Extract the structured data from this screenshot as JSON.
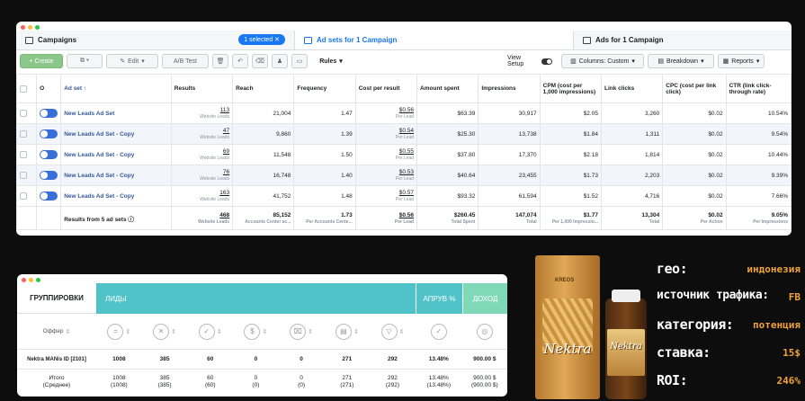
{
  "fb": {
    "tabs": {
      "campaigns": "Campaigns",
      "selected": "1 selected",
      "adsets": "Ad sets for 1 Campaign",
      "ads": "Ads for 1 Campaign"
    },
    "toolbar": {
      "create": "+ Create",
      "edit": "Edit",
      "abtest": "A/B Test",
      "rules": "Rules",
      "view_setup": "View Setup",
      "columns": "Columns: Custom",
      "breakdown": "Breakdown",
      "reports": "Reports"
    },
    "headers": [
      "Ad set",
      "Results",
      "Reach",
      "Frequency",
      "Cost per result",
      "Amount spent",
      "Impressions",
      "CPM (cost per 1,000 impressions)",
      "Link clicks",
      "CPC (cost per link click)",
      "CTR (link click-through rate)"
    ],
    "rows": [
      {
        "name": "New Leads Ad Set",
        "results": "113",
        "results_sub": "Website Leads",
        "reach": "21,004",
        "freq": "1.47",
        "cpr": "$0.56",
        "cpr_sub": "Per Lead",
        "spent": "$63.39",
        "impr": "30,917",
        "cpm": "$2.05",
        "clicks": "3,260",
        "cpc": "$0.02",
        "ctr": "10.54%"
      },
      {
        "name": "New Leads Ad Set - Copy",
        "results": "47",
        "results_sub": "Website Leads",
        "reach": "9,860",
        "freq": "1.39",
        "cpr": "$0.54",
        "cpr_sub": "Per Lead",
        "spent": "$25.30",
        "impr": "13,738",
        "cpm": "$1.84",
        "clicks": "1,311",
        "cpc": "$0.02",
        "ctr": "9.54%"
      },
      {
        "name": "New Leads Ad Set - Copy",
        "results": "69",
        "results_sub": "Website Leads",
        "reach": "11,548",
        "freq": "1.50",
        "cpr": "$0.55",
        "cpr_sub": "Per Lead",
        "spent": "$37.80",
        "impr": "17,370",
        "cpm": "$2.18",
        "clicks": "1,814",
        "cpc": "$0.02",
        "ctr": "10.44%"
      },
      {
        "name": "New Leads Ad Set - Copy",
        "results": "76",
        "results_sub": "Website Leads",
        "reach": "16,748",
        "freq": "1.40",
        "cpr": "$0.53",
        "cpr_sub": "Per Lead",
        "spent": "$40.64",
        "impr": "23,455",
        "cpm": "$1.73",
        "clicks": "2,203",
        "cpc": "$0.02",
        "ctr": "9.39%"
      },
      {
        "name": "New Leads Ad Set - Copy",
        "results": "163",
        "results_sub": "Website Leads",
        "reach": "41,752",
        "freq": "1.48",
        "cpr": "$0.57",
        "cpr_sub": "Per Lead",
        "spent": "$93.32",
        "impr": "61,594",
        "cpm": "$1.52",
        "clicks": "4,716",
        "cpc": "$0.02",
        "ctr": "7.66%"
      }
    ],
    "total": {
      "name": "Results from 5 ad sets",
      "results": "468",
      "results_sub": "Website Leads",
      "reach": "85,152",
      "reach_sub": "Accounts Center ac...",
      "freq": "1.73",
      "freq_sub": "Per Accounts Cente...",
      "cpr": "$0.56",
      "cpr_sub": "Per Lead",
      "spent": "$260.45",
      "spent_sub": "Total Spent",
      "impr": "147,074",
      "impr_sub": "Total",
      "cpm": "$1.77",
      "cpm_sub": "Per 1,000 Impressio...",
      "clicks": "13,304",
      "clicks_sub": "Total",
      "cpc": "$0.02",
      "cpc_sub": "Per Action",
      "ctr": "9.05%",
      "ctr_sub": "Per Impressions"
    }
  },
  "sheet": {
    "grouping": "ГРУППИРОВКИ",
    "leads": "ЛИДЫ",
    "approve": "АПРУВ %",
    "income": "ДОХОД",
    "offer": "Оффер",
    "row1": {
      "label": "Nektra MANis ID [2101]",
      "vals": [
        "1008",
        "385",
        "60",
        "0",
        "0",
        "271",
        "292"
      ],
      "approve": "13.48%",
      "income": "900.00 $"
    },
    "row2": {
      "label1": "Итого",
      "label2": "(Среднее)",
      "vals": [
        "1008",
        "385",
        "60",
        "0",
        "0",
        "271",
        "292"
      ],
      "vals2": [
        "(1008)",
        "(385)",
        "(60)",
        "(0)",
        "(0)",
        "(271)",
        "(292)"
      ],
      "approve": "13.48%",
      "approve2": "(13.48%)",
      "income": "900.00 $",
      "income2": "(900.00 $)"
    }
  },
  "product": {
    "box_label": "Nektra",
    "bottle_label": "Nektra",
    "brand": "KREOS"
  },
  "stats": [
    {
      "key": "гео:",
      "value": "индонезия"
    },
    {
      "key": "источник трафика:",
      "value": "FB"
    },
    {
      "key": "категория:",
      "value": "потенция"
    },
    {
      "key": "ставка:",
      "value": "15$"
    },
    {
      "key": "ROI:",
      "value": "246%"
    }
  ],
  "colors": {
    "fb_blue": "#1877f2",
    "teal": "#4fc3c8",
    "mint": "#7fd9b9",
    "stat_value": "#f2a33a"
  }
}
